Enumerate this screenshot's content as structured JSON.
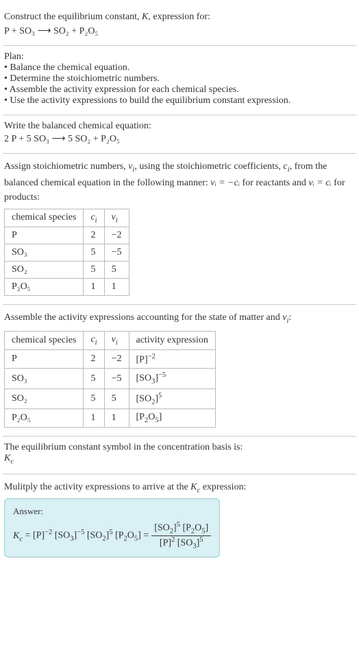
{
  "intro": {
    "line1": "Construct the equilibrium constant, ",
    "line1_var": "K",
    "line1_end": ", expression for:",
    "equation": "P + SO₃  ⟶  SO₂ + P₂O₅"
  },
  "plan": {
    "title": "Plan:",
    "items": [
      "Balance the chemical equation.",
      "Determine the stoichiometric numbers.",
      "Assemble the activity expression for each chemical species.",
      "Use the activity expressions to build the equilibrium constant expression."
    ]
  },
  "balanced": {
    "title": "Write the balanced chemical equation:",
    "equation": "2 P + 5 SO₃  ⟶  5 SO₂ + P₂O₅"
  },
  "stoich": {
    "intro_a": "Assign stoichiometric numbers, ",
    "intro_b": ", using the stoichiometric coefficients, ",
    "intro_c": ", from the balanced chemical equation in the following manner: ",
    "intro_d": " for reactants and ",
    "intro_e": " for products:",
    "nu_eq_neg_c": "νᵢ = −cᵢ",
    "nu_eq_c": "νᵢ = cᵢ",
    "headers": [
      "chemical species",
      "cᵢ",
      "νᵢ"
    ],
    "rows": [
      [
        "P",
        "2",
        "−2"
      ],
      [
        "SO₃",
        "5",
        "−5"
      ],
      [
        "SO₂",
        "5",
        "5"
      ],
      [
        "P₂O₅",
        "1",
        "1"
      ]
    ]
  },
  "activity": {
    "intro_a": "Assemble the activity expressions accounting for the state of matter and ",
    "intro_b": ":",
    "headers": [
      "chemical species",
      "cᵢ",
      "νᵢ",
      "activity expression"
    ],
    "rows": [
      [
        "P",
        "2",
        "−2",
        "[P]⁻²"
      ],
      [
        "SO₃",
        "5",
        "−5",
        "[SO₃]⁻⁵"
      ],
      [
        "SO₂",
        "5",
        "5",
        "[SO₂]⁵"
      ],
      [
        "P₂O₅",
        "1",
        "1",
        "[P₂O₅]"
      ]
    ]
  },
  "symbol": {
    "line": "The equilibrium constant symbol in the concentration basis is:",
    "kc": "K_c"
  },
  "multiply": {
    "line_a": "Mulitply the activity expressions to arrive at the ",
    "line_b": " expression:"
  },
  "answer": {
    "label": "Answer:",
    "lhs": "K_c = [P]⁻² [SO₃]⁻⁵ [SO₂]⁵ [P₂O₅] =",
    "num": "[SO₂]⁵ [P₂O₅]",
    "den": "[P]² [SO₃]⁵"
  }
}
